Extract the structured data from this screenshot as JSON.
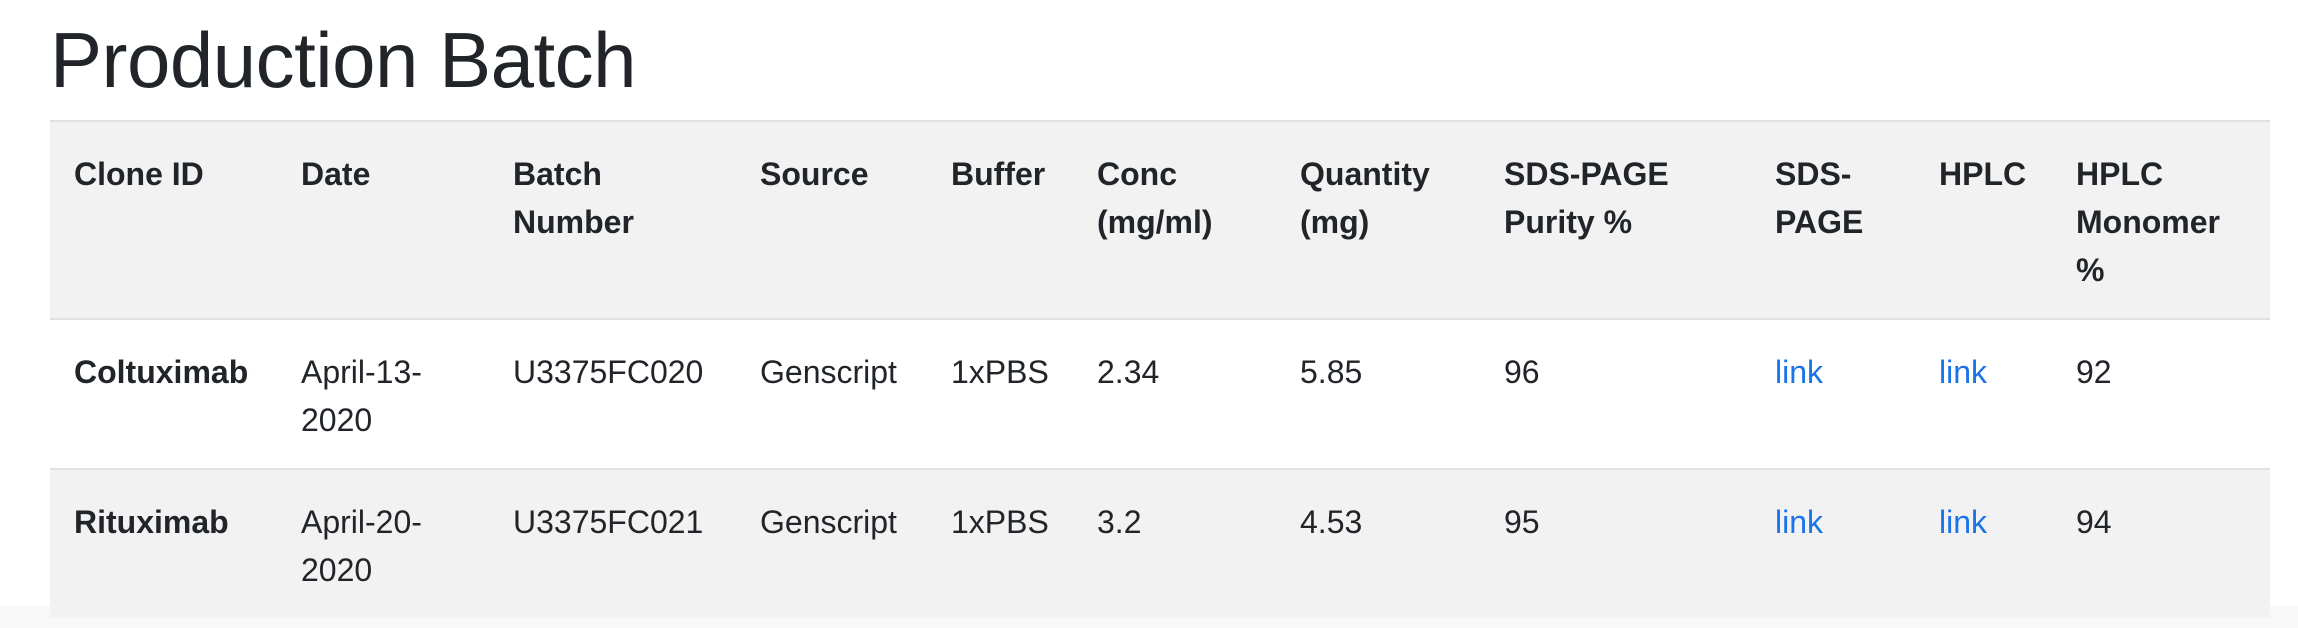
{
  "page": {
    "title": "Production Batch"
  },
  "table": {
    "headers": {
      "clone_id": "Clone ID",
      "date": "Date",
      "batch_number": "Batch Number",
      "source": "Source",
      "buffer": "Buffer",
      "conc": "Conc (mg/ml)",
      "quantity": "Quantity (mg)",
      "sds_purity": "SDS-PAGE Purity %",
      "sds_page": "SDS-PAGE",
      "hplc": "HPLC",
      "hplc_monomer": "HPLC Monomer %"
    },
    "rows": [
      {
        "clone_id": "Coltuximab",
        "date": "April-13-2020",
        "batch_number": "U3375FC020",
        "source": "Genscript",
        "buffer": "1xPBS",
        "conc": "2.34",
        "quantity": "5.85",
        "sds_purity": "96",
        "sds_page": "link",
        "hplc": "link",
        "hplc_monomer": "92"
      },
      {
        "clone_id": "Rituximab",
        "date": "April-20-2020",
        "batch_number": "U3375FC021",
        "source": "Genscript",
        "buffer": "1xPBS",
        "conc": "3.2",
        "quantity": "4.53",
        "sds_purity": "95",
        "sds_page": "link",
        "hplc": "link",
        "hplc_monomer": "94"
      }
    ]
  },
  "colors": {
    "link": "#1a73e8",
    "header_bg": "#f2f2f2",
    "stripe_bg": "#f2f2f2",
    "text": "#212529"
  }
}
